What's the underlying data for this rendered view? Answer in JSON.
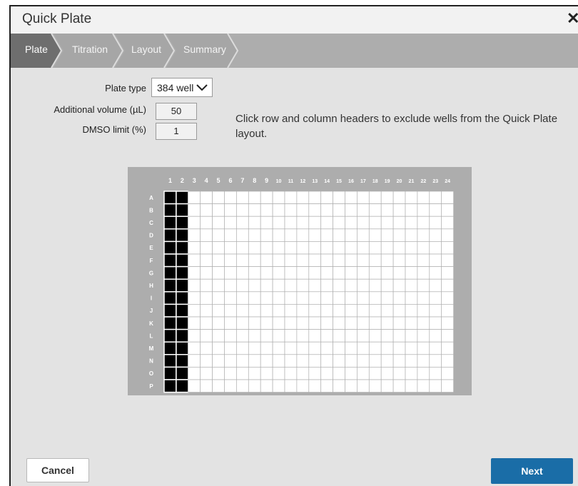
{
  "dialog": {
    "title": "Quick Plate",
    "close_symbol": "✕"
  },
  "wizard": {
    "steps": [
      {
        "label": "Plate",
        "active": true
      },
      {
        "label": "Titration",
        "active": false
      },
      {
        "label": "Layout",
        "active": false
      },
      {
        "label": "Summary",
        "active": false
      }
    ]
  },
  "form": {
    "plate_type_label": "Plate type",
    "plate_type_value": "384 well",
    "additional_volume_label": "Additional volume (µL)",
    "additional_volume_value": "50",
    "dmso_limit_label": "DMSO limit (%)",
    "dmso_limit_value": "1"
  },
  "hint": "Click row and column headers to exclude wells from the Quick Plate layout.",
  "plate": {
    "column_headers": [
      "1",
      "2",
      "3",
      "4",
      "5",
      "6",
      "7",
      "8",
      "9",
      "10",
      "11",
      "12",
      "13",
      "14",
      "15",
      "16",
      "17",
      "18",
      "19",
      "20",
      "21",
      "22",
      "23",
      "24"
    ],
    "row_headers": [
      "A",
      "B",
      "C",
      "D",
      "E",
      "F",
      "G",
      "H",
      "I",
      "J",
      "K",
      "L",
      "M",
      "N",
      "O",
      "P"
    ],
    "excluded_columns": [
      "1",
      "2"
    ],
    "colors": {
      "excluded_well": "#000000",
      "well": "#ffffff",
      "plate_bg": "#adadad"
    }
  },
  "buttons": {
    "cancel": "Cancel",
    "next": "Next"
  },
  "colors": {
    "active_step": "#6e6e6e",
    "inactive_step": "#a6a6a6",
    "primary": "#1a6da7"
  },
  "icons": {
    "close": "close-icon",
    "dropdown": "chevron-down-icon"
  }
}
